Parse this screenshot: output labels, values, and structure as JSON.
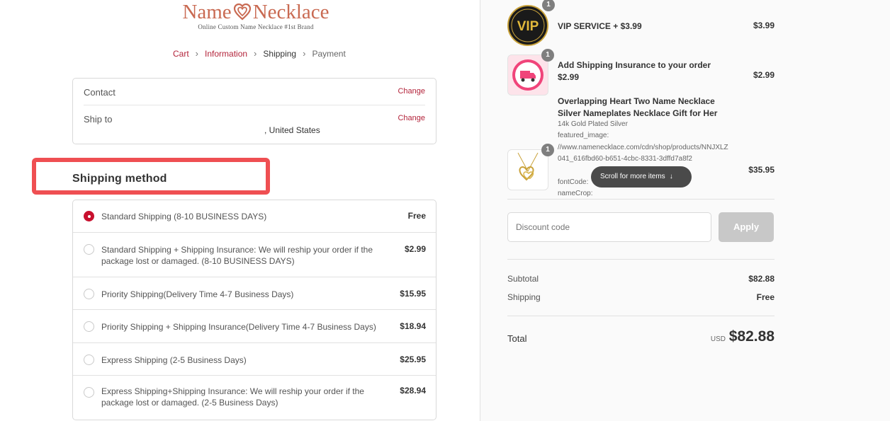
{
  "brand": {
    "name_left": "Name",
    "name_right": "Necklace",
    "tagline": "Online Custom Name Necklace #1st Brand",
    "color": "#c96a52"
  },
  "breadcrumb": {
    "items": [
      "Cart",
      "Information",
      "Shipping",
      "Payment"
    ],
    "current": "Shipping",
    "accent": "#b3233a"
  },
  "review": {
    "contact_label": "Contact",
    "contact_change": "Change",
    "ship_to_label": "Ship to",
    "ship_to_value": ", United States",
    "ship_to_change": "Change"
  },
  "shipping": {
    "title": "Shipping method",
    "methods": [
      {
        "label": "Standard Shipping (8-10 BUSINESS DAYS)",
        "price": "Free",
        "selected": true
      },
      {
        "label": "Standard Shipping + Shipping Insurance: We will reship your order if the package lost or damaged. (8-10 BUSINESS DAYS)",
        "price": "$2.99",
        "selected": false
      },
      {
        "label": "Priority Shipping(Delivery Time 4-7 Business Days)",
        "price": "$15.95",
        "selected": false
      },
      {
        "label": "Priority Shipping + Shipping Insurance(Delivery Time 4-7 Business Days)",
        "price": "$18.94",
        "selected": false
      },
      {
        "label": "Express Shipping (2-5 Business Days)",
        "price": "$25.95",
        "selected": false
      },
      {
        "label": "Express Shipping+Shipping Insurance: We will reship your order if the package lost or damaged. (2-5 Business Days)",
        "price": "$28.94",
        "selected": false
      }
    ]
  },
  "order": {
    "items": [
      {
        "title": "VIP SERVICE + $3.99",
        "price": "$3.99",
        "qty": "1",
        "icon": "vip-badge-icon"
      },
      {
        "title": "Add Shipping Insurance to your order $2.99",
        "price": "$2.99",
        "qty": "1",
        "icon": "shipping-insurance-icon"
      },
      {
        "title": "Overlapping Heart Two Name Necklace Silver Nameplates Necklace Gift for Her",
        "price": "$35.95",
        "qty": "1",
        "variant": "14k Gold Plated Silver",
        "prop1": "featured_image:",
        "prop2": "//www.namenecklace.com/cdn/shop/products/NNJXLZ041_616fbd60-b651-4cbc-8331-3dffd7a8f2",
        "prop3": "fontCode:",
        "prop4": "nameCrop:",
        "icon": "necklace-thumbnail"
      }
    ],
    "scroll_hint": "Scroll for more items",
    "discount_placeholder": "Discount code",
    "apply_label": "Apply",
    "subtotal_label": "Subtotal",
    "subtotal_value": "$82.88",
    "shipping_label": "Shipping",
    "shipping_value": "Free",
    "total_label": "Total",
    "currency": "USD",
    "total_value": "$82.88"
  }
}
